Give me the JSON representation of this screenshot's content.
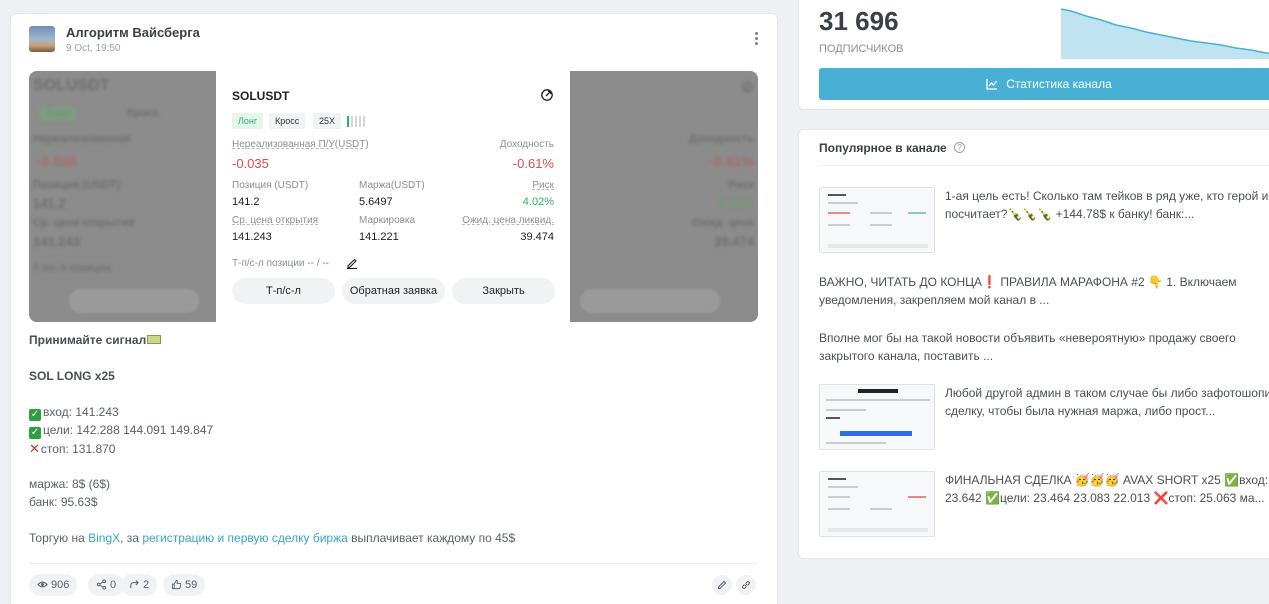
{
  "post": {
    "channel_name": "Алгоритм Вайсберга",
    "date": "9 Oct, 19:50",
    "trade_card": {
      "symbol": "SOLUSDT",
      "tags": [
        "Лонг",
        "Кросс",
        "25X"
      ],
      "unrealized_label": "Нереализованная П/У(USDT)",
      "unrealized_value": "-0.035",
      "yield_label": "Доходность",
      "yield_value": "-0.61%",
      "position_label": "Позиция (USDT)",
      "position_value": "141.2",
      "margin_label": "Маржа(USDT)",
      "margin_value": "5.6497",
      "risk_label": "Риск",
      "risk_value": "4.02%",
      "open_price_label": "Ср. цена открытия",
      "open_price_value": "141.243",
      "mark_label": "Маркировка",
      "mark_value": "141.221",
      "liq_label": "Ожид. цена ликвид.",
      "liq_value": "39.474",
      "tpsl_label": "Т-п/с-л позиции",
      "tpsl_tp": "--",
      "tpsl_sep": " / ",
      "tpsl_sl": "--",
      "buttons": [
        "Т-п/с-л",
        "Обратная заявка",
        "Закрыть"
      ]
    },
    "text": {
      "line1": "Принимайте сигнал",
      "line2": "SOL LONG x25",
      "entry": "вход: 141.243",
      "targets": "цели: 142.288 144.091 149.847",
      "stop": "стоп: 131.870",
      "margin": "маржа: 8$ (6$)",
      "bank": "банк: 95.63$",
      "promo_prefix": "Торгую на ",
      "promo_link1": "BingX",
      "promo_mid": ", за ",
      "promo_link2": "регистрацию и первую сделку биржа",
      "promo_suffix": " выплачивает каждому по 45$"
    },
    "footer": {
      "views": "906",
      "shares": "0",
      "forwards": "2",
      "likes": "59"
    }
  },
  "sidebar": {
    "subscribers_count": "31 696",
    "subscribers_label": "подписчиков",
    "stats_button": "Статистика канала",
    "popular_title": "Популярное в канале",
    "popular_items": [
      {
        "text": "1-ая цель есть! Сколько там тейков в ряд уже, кто герой и посчитает?🍾🍾🍾 +144.78$ к банку! банк:...",
        "line1": "1-ая цель есть! Сколько там тейков в ряд уже, кто герой и",
        "line2": "посчитает?🍾🍾🍾 +144.78$ к банку! банк:..."
      },
      {
        "line1": "ВАЖНО, ЧИТАТЬ ДО КОНЦА❗ ПРАВИЛА МАРАФОНА #2 👇 1. Включаем",
        "line2": "уведомления, закрепляем мой канал в ..."
      },
      {
        "line1": "Вполне мог бы на такой новости объявить «невероятную» продажу своего",
        "line2": "закрытого канала, поставить ..."
      },
      {
        "line1": "Любой другой админ в таком случае бы либо зафотошопил",
        "line2": "сделку, чтобы была нужная маржа, либо прост..."
      },
      {
        "line1": "ФИНАЛЬНАЯ СДЕЛКА 🥳🥳🥳 AVAX SHORT x25 ✅вход:",
        "line2": "23.642 ✅цели: 23.464 23.083 22.013 ❌стоп: 25.063 ма..."
      }
    ]
  },
  "colors": {
    "accent": "#48b0d5",
    "green": "#2bb26a",
    "red": "#e04a4a",
    "link": "#3ba3c7"
  }
}
